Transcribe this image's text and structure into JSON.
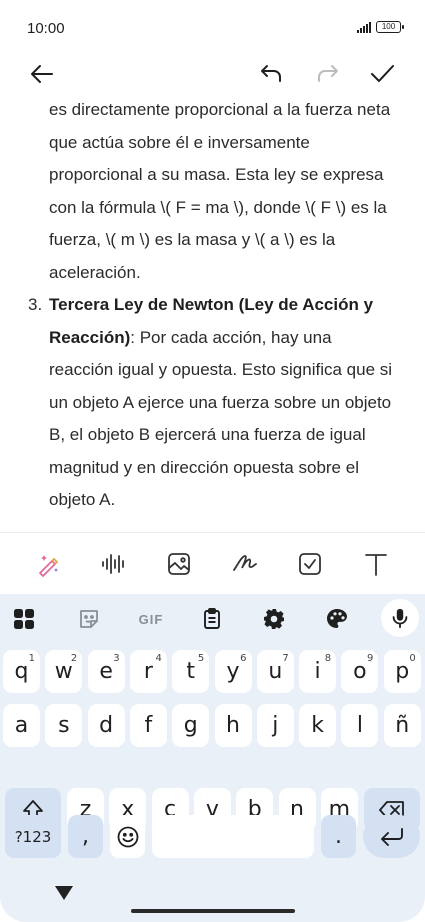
{
  "status": {
    "time": "10:00",
    "battery": "100"
  },
  "note": {
    "paragraph": "es directamente proporcional a la fuerza neta que actúa sobre él e inversamente proporcional a su masa. Esta ley se expresa con la fórmula \\( F = ma \\), donde \\( F \\) es la fuerza, \\( m \\) es la masa y \\( a \\) es la aceleración.",
    "item3": {
      "number": "3.",
      "title": "Tercera Ley de Newton (Ley de Acción y Reacción)",
      "text": ": Por cada acción, hay una reacción igual y opuesta. Esto significa que si un objeto A ejerce una fuerza sobre un objeto B, el objeto B ejercerá una fuerza de igual magnitud y en dirección opuesta sobre el objeto A."
    }
  },
  "toolbar_icons": [
    "ai-pen-icon",
    "audio-wave-icon",
    "image-icon",
    "handwriting-icon",
    "checkbox-icon",
    "text-icon"
  ],
  "keyboard": {
    "top": {
      "gif": "GIF"
    },
    "row1": [
      {
        "k": "q",
        "h": "1"
      },
      {
        "k": "w",
        "h": "2"
      },
      {
        "k": "e",
        "h": "3"
      },
      {
        "k": "r",
        "h": "4"
      },
      {
        "k": "t",
        "h": "5"
      },
      {
        "k": "y",
        "h": "6"
      },
      {
        "k": "u",
        "h": "7"
      },
      {
        "k": "i",
        "h": "8"
      },
      {
        "k": "o",
        "h": "9"
      },
      {
        "k": "p",
        "h": "0"
      }
    ],
    "row2": [
      "a",
      "s",
      "d",
      "f",
      "g",
      "h",
      "j",
      "k",
      "l",
      "ñ"
    ],
    "row3": [
      "z",
      "x",
      "c",
      "v",
      "b",
      "n",
      "m"
    ],
    "symbols_label": "?123",
    "comma": ",",
    "period": "."
  },
  "colors": {
    "keyboard_bg": "#eaf0f7",
    "mod_key": "#d4e1f3",
    "accent_pen": "#e06a9a"
  }
}
